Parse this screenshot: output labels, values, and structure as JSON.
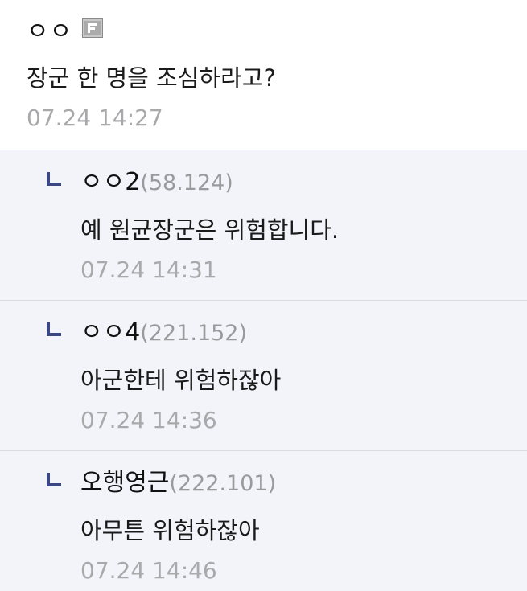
{
  "comment": {
    "nickname": "ㅇㅇ",
    "badge_icon": "fixed-nick-icon",
    "text": "장군 한 명을 조심하라고?",
    "date": "07.24 14:27"
  },
  "replies": [
    {
      "icon": "reply-arrow-icon",
      "name": "ㅇㅇ2",
      "ip": "(58.124)",
      "text": "예 원균장군은 위험합니다.",
      "date": "07.24 14:31"
    },
    {
      "icon": "reply-arrow-icon",
      "name": "ㅇㅇ4",
      "ip": "(221.152)",
      "text": "아군한테 위험하잖아",
      "date": "07.24 14:36"
    },
    {
      "icon": "reply-arrow-icon",
      "name": "오행영근",
      "ip": "(222.101)",
      "text": "아무튼 위험하잖아",
      "date": "07.24 14:46"
    }
  ],
  "colors": {
    "reply_background": "#f3f4f9",
    "divider": "#d9dbe3",
    "arrow": "#3b4780",
    "muted_text": "#a9a9ab"
  }
}
